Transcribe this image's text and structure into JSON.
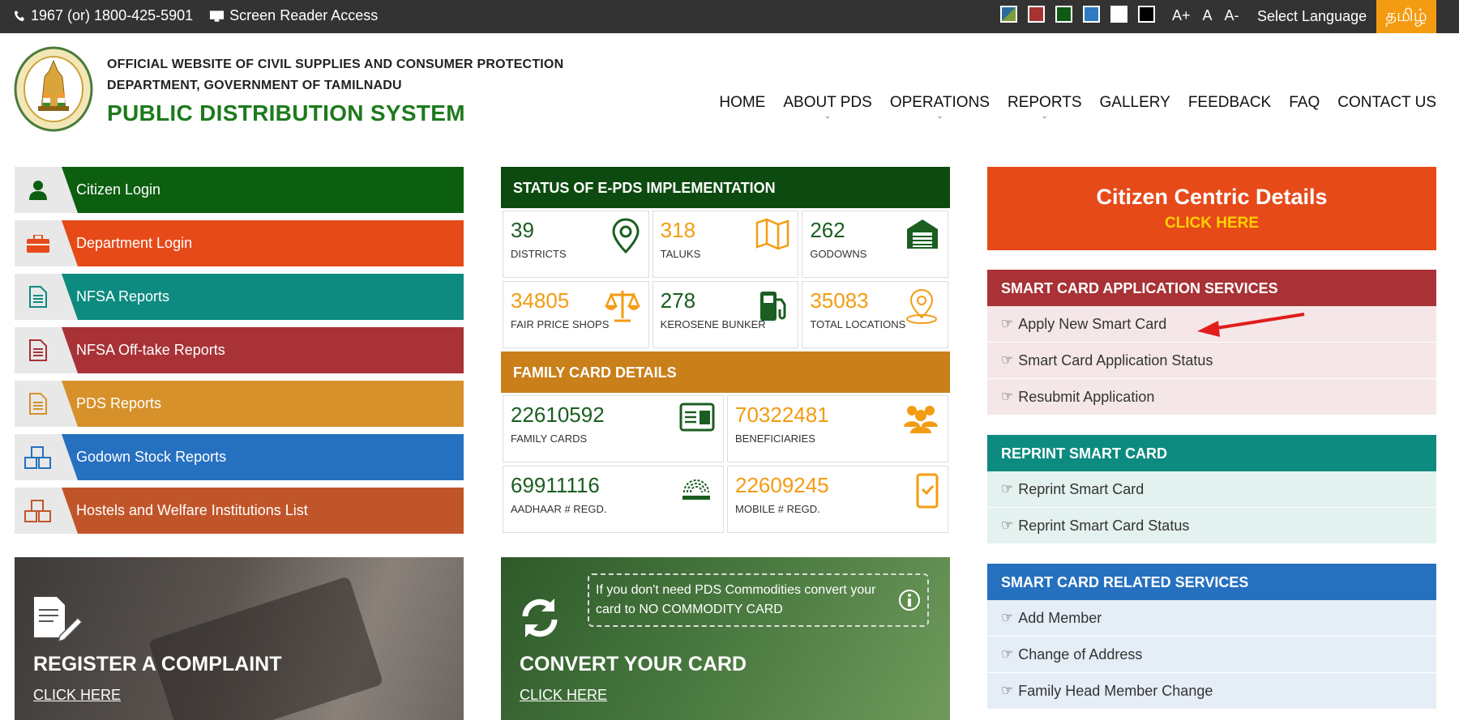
{
  "topbar": {
    "phone": "1967 (or) 1800-425-5901",
    "screen_reader": "Screen Reader Access",
    "themes": [
      "#2d6b9c",
      "#a63232",
      "#0f5a12",
      "#2e7bc4",
      "#ffffff",
      "#000000"
    ],
    "font_plus": "A+",
    "font_normal": "A",
    "font_minus": "A-",
    "select_language": "Select Language",
    "tamil": "தமிழ்"
  },
  "header": {
    "org_line1": "OFFICIAL WEBSITE OF CIVIL SUPPLIES AND CONSUMER PROTECTION",
    "org_line2": "DEPARTMENT, GOVERNMENT OF TAMILNADU",
    "site_title": "PUBLIC DISTRIBUTION SYSTEM"
  },
  "nav": {
    "items": [
      {
        "label": "HOME"
      },
      {
        "label": "ABOUT PDS"
      },
      {
        "label": "OPERATIONS"
      },
      {
        "label": "REPORTS"
      },
      {
        "label": "GALLERY"
      },
      {
        "label": "FEEDBACK"
      },
      {
        "label": "FAQ"
      },
      {
        "label": "CONTACT US"
      }
    ]
  },
  "quick_links": [
    {
      "label": "Citizen Login",
      "color": "#0d5f10",
      "icon": "user-icon"
    },
    {
      "label": "Department Login",
      "color": "#e64a19",
      "icon": "briefcase-icon"
    },
    {
      "label": "NFSA Reports",
      "color": "#0d8b80",
      "icon": "document-icon"
    },
    {
      "label": "NFSA Off-take Reports",
      "color": "#a83236",
      "icon": "document-icon"
    },
    {
      "label": "PDS Reports",
      "color": "#d6912a",
      "icon": "document-icon"
    },
    {
      "label": "Godown Stock Reports",
      "color": "#2670c0",
      "icon": "boxes-icon"
    },
    {
      "label": "Hostels and Welfare Institutions List",
      "color": "#c1552a",
      "icon": "boxes-icon"
    }
  ],
  "epds": {
    "title": "STATUS OF E-PDS IMPLEMENTATION",
    "stats": [
      {
        "value": "39",
        "label": "DISTRICTS",
        "icon": "map-pin-icon"
      },
      {
        "value": "318",
        "label": "TALUKS",
        "icon": "map-icon"
      },
      {
        "value": "262",
        "label": "GODOWNS",
        "icon": "warehouse-icon"
      },
      {
        "value": "34805",
        "label": "FAIR PRICE SHOPS",
        "icon": "scales-icon"
      },
      {
        "value": "278",
        "label": "KEROSENE BUNKER",
        "icon": "fuel-icon"
      },
      {
        "value": "35083",
        "label": "TOTAL LOCATIONS",
        "icon": "location-icon"
      }
    ]
  },
  "family": {
    "title": "FAMILY CARD DETAILS",
    "stats": [
      {
        "value": "22610592",
        "label": "FAMILY CARDS",
        "icon": "id-card-icon"
      },
      {
        "value": "70322481",
        "label": "BENEFICIARIES",
        "icon": "people-icon"
      },
      {
        "value": "69911116",
        "label": "AADHAAR # REGD.",
        "icon": "aadhaar-icon"
      },
      {
        "value": "22609245",
        "label": "MOBILE # REGD.",
        "icon": "mobile-icon"
      }
    ]
  },
  "citizen_centric": {
    "title": "Citizen Centric Details",
    "link": "CLICK HERE"
  },
  "smart_card_app": {
    "title": "SMART CARD APPLICATION SERVICES",
    "items": [
      "Apply New Smart Card",
      "Smart Card Application Status",
      "Resubmit Application"
    ]
  },
  "reprint": {
    "title": "REPRINT SMART CARD",
    "items": [
      "Reprint Smart Card",
      "Reprint Smart Card Status"
    ]
  },
  "related": {
    "title": "SMART CARD RELATED SERVICES",
    "items": [
      "Add Member",
      "Change of Address",
      "Family Head Member Change"
    ]
  },
  "complaint": {
    "title": "REGISTER A COMPLAINT",
    "link": "CLICK HERE"
  },
  "convert": {
    "title": "CONVERT YOUR CARD",
    "link": "CLICK HERE",
    "note": "If you don't need PDS Commodities convert your card to NO COMMODITY CARD"
  }
}
